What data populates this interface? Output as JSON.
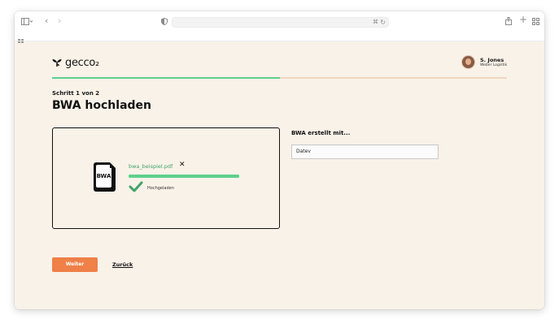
{
  "logo": {
    "text": "gecco₂"
  },
  "user": {
    "name": "S. Jones",
    "role": "Weber Logistik"
  },
  "progress": {
    "fraction": 0.5
  },
  "step": {
    "label": "Schritt 1 von 2"
  },
  "page": {
    "title": "BWA hochladen"
  },
  "upload": {
    "doc_label": "BWA",
    "file_name": "bwa_beispiel.pdf",
    "progress_fraction": 1.0,
    "status": "Hochgeladen"
  },
  "form": {
    "label": "BWA erstellt mit...",
    "selected": "Datev"
  },
  "actions": {
    "next": "Weiter",
    "back": "Zurück"
  },
  "colors": {
    "accent_green": "#5dd08c",
    "button_orange": "#ee8048",
    "background": "#f9f2e8"
  }
}
